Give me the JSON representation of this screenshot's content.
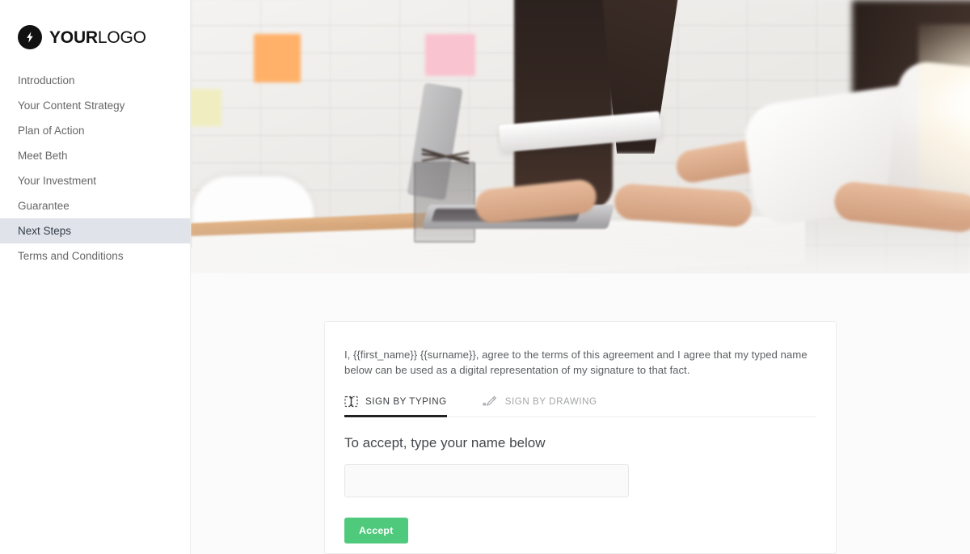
{
  "sidebar": {
    "logo": {
      "icon": "lightning-bolt-icon",
      "text_bold": "YOUR",
      "text_light": "LOGO"
    },
    "items": [
      {
        "label": "Introduction",
        "active": false
      },
      {
        "label": "Your Content Strategy",
        "active": false
      },
      {
        "label": "Plan of Action",
        "active": false
      },
      {
        "label": "Meet Beth",
        "active": false
      },
      {
        "label": "Your Investment",
        "active": false
      },
      {
        "label": "Guarantee",
        "active": false
      },
      {
        "label": "Next Steps",
        "active": true
      },
      {
        "label": "Terms and Conditions",
        "active": false
      }
    ]
  },
  "hero": {
    "alt": "Business team working together at a desk with a laptop and tablet, sunlight flare"
  },
  "card": {
    "agreement_text": "I, {{first_name}} {{surname}}, agree to the terms of this agreement and I agree that my typed name below can be used as a digital representation of my signature to that fact.",
    "tabs": [
      {
        "label": "SIGN BY TYPING",
        "icon": "text-cursor-icon",
        "active": true
      },
      {
        "label": "SIGN BY DRAWING",
        "icon": "pen-draw-icon",
        "active": false
      }
    ],
    "accept_heading": "To accept, type your name below",
    "name_input": {
      "value": "",
      "placeholder": ""
    },
    "accept_button": "Accept"
  },
  "colors": {
    "accent_green": "#4fc97c",
    "sidebar_active_bg": "#e0e3ea",
    "page_bg": "#fbfbfb",
    "tab_active_underline": "#222222"
  }
}
